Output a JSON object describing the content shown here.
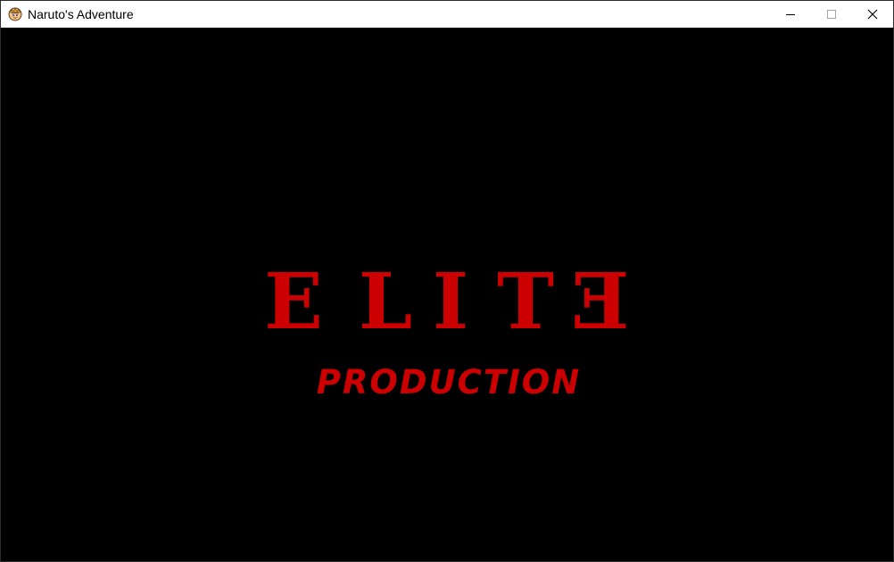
{
  "window": {
    "title": "Naruto's Adventure",
    "app_icon": "naruto-face-icon",
    "controls": {
      "minimize_icon": "minimize-icon",
      "maximize_icon": "maximize-icon",
      "close_icon": "close-icon"
    }
  },
  "splash": {
    "logo_letters": [
      "E",
      "L",
      "I",
      "T",
      "Ǝ"
    ],
    "subtitle": "PRODUCTION",
    "color": "#cc0000",
    "background": "#000000"
  }
}
